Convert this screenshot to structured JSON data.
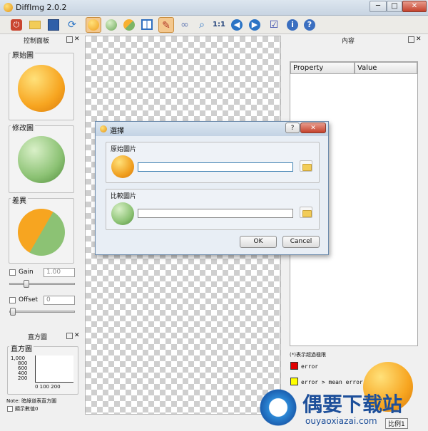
{
  "window": {
    "title": "DiffImg 2.0.2",
    "minimize": "─",
    "maximize": "□",
    "close": "✕"
  },
  "toolbar": {
    "active_index": 5
  },
  "control_panel": {
    "title": "控制面板",
    "original_label": "原始圖",
    "modified_label": "修改圖",
    "diff_label": "差異",
    "gain_label": "Gain",
    "gain_value": "1.00",
    "offset_label": "Offset",
    "offset_value": "0"
  },
  "histogram": {
    "title": "直方圖",
    "group_label": "直方圖",
    "y_ticks": [
      "1,000",
      "800",
      "600",
      "400",
      "200"
    ],
    "x_ticks": "0 100 200",
    "note": "Note: 暗綠道表直方圖",
    "show_values_label": "顯示數值0"
  },
  "info_panel": {
    "title": "內容",
    "col_property": "Property",
    "col_value": "Value",
    "legend_caption": "(*)表示超過極限",
    "error_label": "error",
    "mean_error_label": "error > mean error",
    "error_color": "#e00000",
    "mean_color": "#ffff00"
  },
  "dialog": {
    "title": "選擇",
    "help": "?",
    "close": "✕",
    "original_group": "原始圖片",
    "compare_group": "比較圖片",
    "ok": "OK",
    "cancel": "Cancel"
  },
  "status": {
    "zoom": "比例1"
  },
  "watermark": {
    "name": "偶要下载站",
    "url": "ouyaoxiazai.com"
  }
}
